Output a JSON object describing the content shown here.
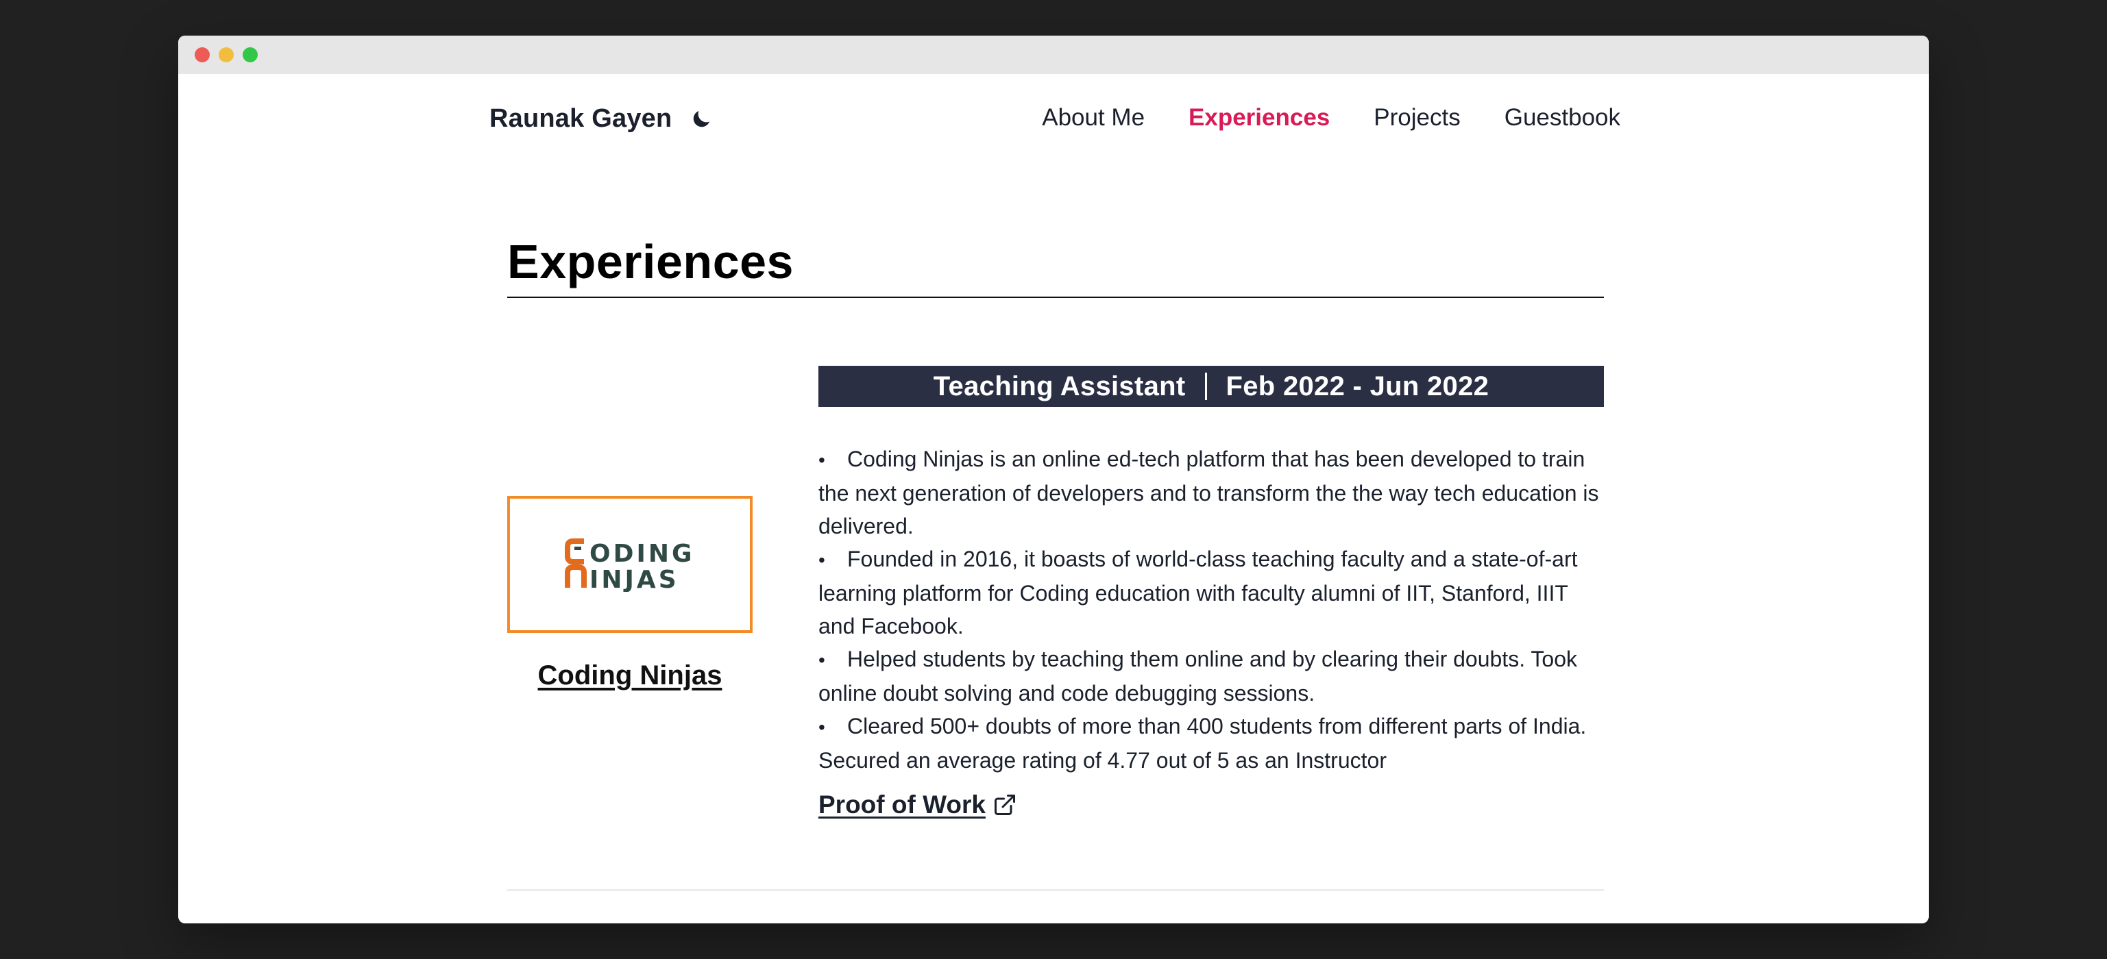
{
  "brand": {
    "name": "Raunak Gayen",
    "theme_icon": "moon-icon"
  },
  "nav": {
    "items": [
      {
        "label": "About Me",
        "active": false
      },
      {
        "label": "Experiences",
        "active": true
      },
      {
        "label": "Projects",
        "active": false
      },
      {
        "label": "Guestbook",
        "active": false
      }
    ]
  },
  "page": {
    "title": "Experiences"
  },
  "experience": {
    "company": "Coding Ninjas",
    "logo": {
      "line1": "ODING",
      "line2": "INJAS",
      "icon": "coding-ninjas-logo"
    },
    "role": "Teaching Assistant",
    "period": "Feb 2022 - Jun 2022",
    "bullets": [
      "Coding Ninjas is an online ed-tech platform that has been developed to train the next generation of developers and to transform the the way tech education is delivered.",
      "Founded in 2016, it boasts of world-class teaching faculty and a state-of-art learning platform for Coding education with faculty alumni of IIT, Stanford, IIIT and Facebook.",
      "Helped students by teaching them online and by clearing their doubts. Took online doubt solving and code debugging sessions.",
      "Cleared 500+ doubts of more than 400 students from different parts of India. Secured an average rating of 4.77 out of 5 as an Instructor"
    ],
    "proof_label": "Proof of Work",
    "proof_icon": "external-link-icon"
  },
  "colors": {
    "accent": "#d81b55",
    "role_bar": "#2b2f44",
    "logo_border": "#f28c28",
    "logo_orange": "#e36b1e",
    "logo_dark": "#2f4a45"
  }
}
